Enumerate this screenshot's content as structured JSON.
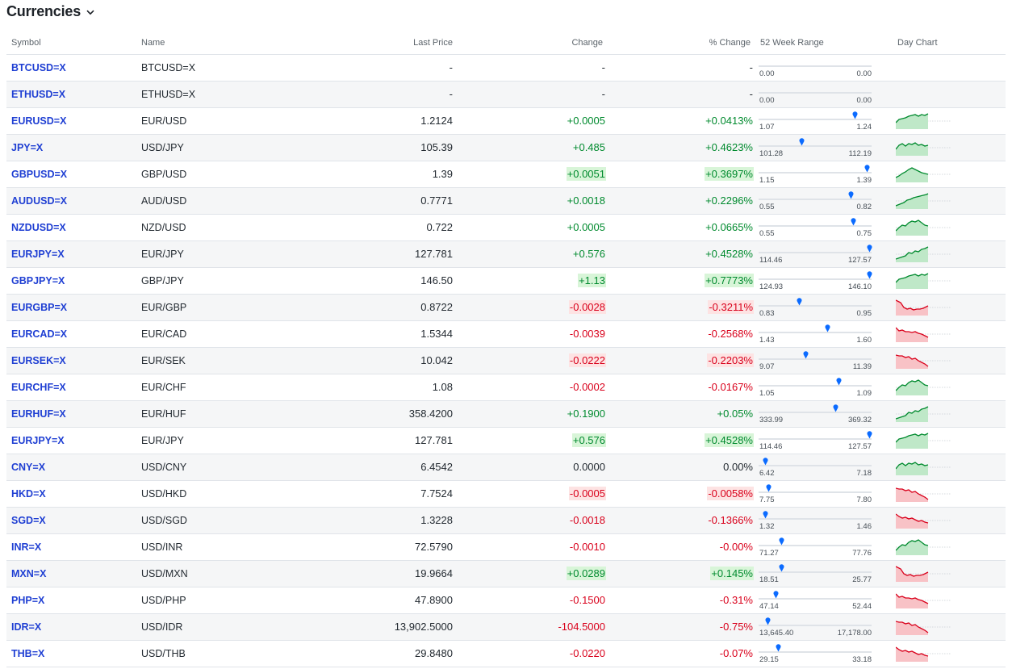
{
  "page": {
    "title": "Currencies"
  },
  "columns": {
    "symbol": "Symbol",
    "name": "Name",
    "last": "Last Price",
    "change": "Change",
    "pchange": "% Change",
    "range": "52 Week Range",
    "chart": "Day Chart"
  },
  "colors": {
    "positive": "#008a2e",
    "negative": "#d9001b",
    "link": "#1f3fd3",
    "marker": "#0b6bff"
  },
  "icons": {
    "title_menu": "chevron-down-icon",
    "range_marker": "pin-marker-icon"
  },
  "rows": [
    {
      "symbol": "BTCUSD=X",
      "name": "BTCUSD=X",
      "last": "-",
      "change": "-",
      "pchange": "-",
      "dir": "none",
      "flash": false,
      "lo": "0.00",
      "hi": "0.00",
      "pos": null,
      "chart": null
    },
    {
      "symbol": "ETHUSD=X",
      "name": "ETHUSD=X",
      "last": "-",
      "change": "-",
      "pchange": "-",
      "dir": "none",
      "flash": false,
      "lo": "0.00",
      "hi": "0.00",
      "pos": null,
      "chart": null
    },
    {
      "symbol": "EURUSD=X",
      "name": "EUR/USD",
      "last": "1.2124",
      "change": "+0.0005",
      "pchange": "+0.0413%",
      "dir": "pos",
      "flash": false,
      "lo": "1.07",
      "hi": "1.24",
      "pos": 0.87,
      "chart": "green"
    },
    {
      "symbol": "JPY=X",
      "name": "USD/JPY",
      "last": "105.39",
      "change": "+0.485",
      "pchange": "+0.4623%",
      "dir": "pos",
      "flash": false,
      "lo": "101.28",
      "hi": "112.19",
      "pos": 0.38,
      "chart": "green"
    },
    {
      "symbol": "GBPUSD=X",
      "name": "GBP/USD",
      "last": "1.39",
      "change": "+0.0051",
      "pchange": "+0.3697%",
      "dir": "pos",
      "flash": true,
      "lo": "1.15",
      "hi": "1.39",
      "pos": 0.98,
      "chart": "green"
    },
    {
      "symbol": "AUDUSD=X",
      "name": "AUD/USD",
      "last": "0.7771",
      "change": "+0.0018",
      "pchange": "+0.2296%",
      "dir": "pos",
      "flash": false,
      "lo": "0.55",
      "hi": "0.82",
      "pos": 0.83,
      "chart": "green"
    },
    {
      "symbol": "NZDUSD=X",
      "name": "NZD/USD",
      "last": "0.722",
      "change": "+0.0005",
      "pchange": "+0.0665%",
      "dir": "pos",
      "flash": false,
      "lo": "0.55",
      "hi": "0.75",
      "pos": 0.85,
      "chart": "green"
    },
    {
      "symbol": "EURJPY=X",
      "name": "EUR/JPY",
      "last": "127.781",
      "change": "+0.576",
      "pchange": "+0.4528%",
      "dir": "pos",
      "flash": false,
      "lo": "114.46",
      "hi": "127.57",
      "pos": 1.0,
      "chart": "green"
    },
    {
      "symbol": "GBPJPY=X",
      "name": "GBP/JPY",
      "last": "146.50",
      "change": "+1.13",
      "pchange": "+0.7773%",
      "dir": "pos",
      "flash": true,
      "lo": "124.93",
      "hi": "146.10",
      "pos": 1.0,
      "chart": "green"
    },
    {
      "symbol": "EURGBP=X",
      "name": "EUR/GBP",
      "last": "0.8722",
      "change": "-0.0028",
      "pchange": "-0.3211%",
      "dir": "neg",
      "flash": true,
      "lo": "0.83",
      "hi": "0.95",
      "pos": 0.36,
      "chart": "red"
    },
    {
      "symbol": "EURCAD=X",
      "name": "EUR/CAD",
      "last": "1.5344",
      "change": "-0.0039",
      "pchange": "-0.2568%",
      "dir": "neg",
      "flash": false,
      "lo": "1.43",
      "hi": "1.60",
      "pos": 0.62,
      "chart": "red"
    },
    {
      "symbol": "EURSEK=X",
      "name": "EUR/SEK",
      "last": "10.042",
      "change": "-0.0222",
      "pchange": "-0.2203%",
      "dir": "neg",
      "flash": true,
      "lo": "9.07",
      "hi": "11.39",
      "pos": 0.42,
      "chart": "red"
    },
    {
      "symbol": "EURCHF=X",
      "name": "EUR/CHF",
      "last": "1.08",
      "change": "-0.0002",
      "pchange": "-0.0167%",
      "dir": "neg",
      "flash": false,
      "lo": "1.05",
      "hi": "1.09",
      "pos": 0.72,
      "chart": "green"
    },
    {
      "symbol": "EURHUF=X",
      "name": "EUR/HUF",
      "last": "358.4200",
      "change": "+0.1900",
      "pchange": "+0.05%",
      "dir": "pos",
      "flash": false,
      "lo": "333.99",
      "hi": "369.32",
      "pos": 0.69,
      "chart": "green"
    },
    {
      "symbol": "EURJPY=X",
      "name": "EUR/JPY",
      "last": "127.781",
      "change": "+0.576",
      "pchange": "+0.4528%",
      "dir": "pos",
      "flash": true,
      "lo": "114.46",
      "hi": "127.57",
      "pos": 1.0,
      "chart": "green"
    },
    {
      "symbol": "CNY=X",
      "name": "USD/CNY",
      "last": "6.4542",
      "change": "0.0000",
      "pchange": "0.00%",
      "dir": "none",
      "flash": false,
      "lo": "6.42",
      "hi": "7.18",
      "pos": 0.05,
      "chart": "green"
    },
    {
      "symbol": "HKD=X",
      "name": "USD/HKD",
      "last": "7.7524",
      "change": "-0.0005",
      "pchange": "-0.0058%",
      "dir": "neg",
      "flash": true,
      "lo": "7.75",
      "hi": "7.80",
      "pos": 0.08,
      "chart": "red"
    },
    {
      "symbol": "SGD=X",
      "name": "USD/SGD",
      "last": "1.3228",
      "change": "-0.0018",
      "pchange": "-0.1366%",
      "dir": "neg",
      "flash": false,
      "lo": "1.32",
      "hi": "1.46",
      "pos": 0.05,
      "chart": "red"
    },
    {
      "symbol": "INR=X",
      "name": "USD/INR",
      "last": "72.5790",
      "change": "-0.0010",
      "pchange": "-0.00%",
      "dir": "neg",
      "flash": false,
      "lo": "71.27",
      "hi": "77.76",
      "pos": 0.2,
      "chart": "green"
    },
    {
      "symbol": "MXN=X",
      "name": "USD/MXN",
      "last": "19.9664",
      "change": "+0.0289",
      "pchange": "+0.145%",
      "dir": "pos",
      "flash": true,
      "lo": "18.51",
      "hi": "25.77",
      "pos": 0.2,
      "chart": "red"
    },
    {
      "symbol": "PHP=X",
      "name": "USD/PHP",
      "last": "47.8900",
      "change": "-0.1500",
      "pchange": "-0.31%",
      "dir": "neg",
      "flash": false,
      "lo": "47.14",
      "hi": "52.44",
      "pos": 0.15,
      "chart": "red"
    },
    {
      "symbol": "IDR=X",
      "name": "USD/IDR",
      "last": "13,902.5000",
      "change": "-104.5000",
      "pchange": "-0.75%",
      "dir": "neg",
      "flash": false,
      "lo": "13,645.40",
      "hi": "17,178.00",
      "pos": 0.07,
      "chart": "red"
    },
    {
      "symbol": "THB=X",
      "name": "USD/THB",
      "last": "29.8480",
      "change": "-0.0220",
      "pchange": "-0.07%",
      "dir": "neg",
      "flash": false,
      "lo": "29.15",
      "hi": "33.18",
      "pos": 0.17,
      "chart": "red"
    }
  ]
}
